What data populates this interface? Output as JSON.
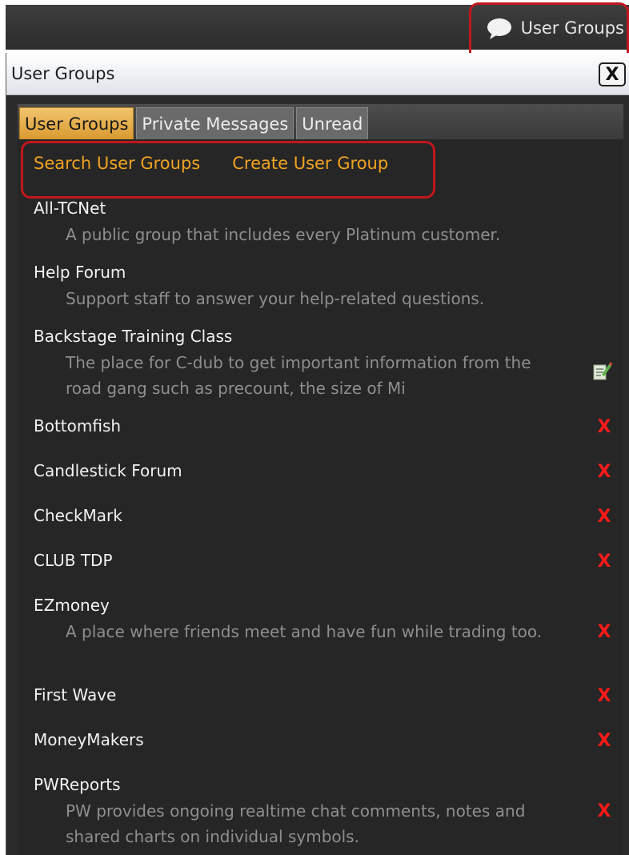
{
  "topbar": {
    "button_label": "User Groups",
    "icon": "chat-bubble-icon"
  },
  "panel": {
    "title": "User Groups",
    "close_label": "X"
  },
  "tabs": [
    {
      "label": "User Groups",
      "active": true
    },
    {
      "label": "Private Messages",
      "active": false
    },
    {
      "label": "Unread",
      "active": false
    }
  ],
  "actions": {
    "search": "Search User Groups",
    "create": "Create User Group"
  },
  "groups": [
    {
      "name": "All-TCNet",
      "desc": "A public group that includes every Platinum customer.",
      "control": "none"
    },
    {
      "name": "Help Forum",
      "desc": "Support staff to answer your help-related questions.",
      "control": "none"
    },
    {
      "name": "Backstage Training Class",
      "desc": "The place for C-dub to get important information from the road gang such as precount, the size of Mi",
      "control": "edit"
    },
    {
      "name": "Bottomfish",
      "desc": "",
      "control": "delete"
    },
    {
      "name": "Candlestick Forum",
      "desc": "",
      "control": "delete"
    },
    {
      "name": "CheckMark",
      "desc": "",
      "control": "delete"
    },
    {
      "name": "CLUB TDP",
      "desc": "",
      "control": "delete"
    },
    {
      "name": "EZmoney",
      "desc": "A place where friends meet and have fun while trading too.",
      "control": "delete"
    },
    {
      "name": "First Wave",
      "desc": "",
      "control": "delete"
    },
    {
      "name": "MoneyMakers",
      "desc": "",
      "control": "delete"
    },
    {
      "name": "PWReports",
      "desc": "PW provides ongoing realtime chat comments, notes and shared charts on individual symbols.",
      "control": "delete"
    }
  ],
  "delete_glyph": "X",
  "colors": {
    "accent": "#f0a321",
    "delete": "#ff1a1a",
    "highlight": "#c0171e",
    "active_tab": "#e0a640"
  }
}
